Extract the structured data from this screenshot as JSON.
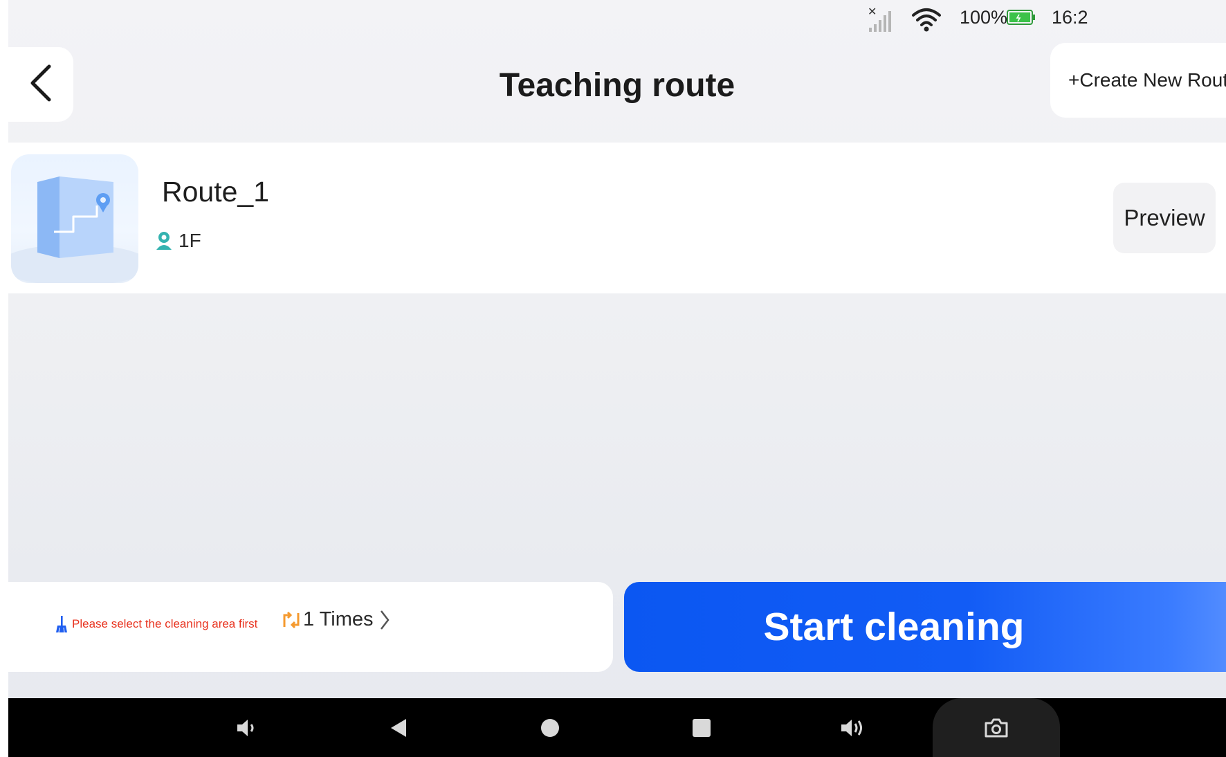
{
  "status_bar": {
    "battery_percent": "100%",
    "time": "16:2",
    "icons": [
      "no-signal-icon",
      "wifi-icon",
      "battery-icon"
    ]
  },
  "header": {
    "title": "Teaching route",
    "create_button": "+Create New Route",
    "back_icon": "back-arrow-icon"
  },
  "routes": [
    {
      "name": "Route_1",
      "floor": "1F",
      "preview_label": "Preview",
      "thumbnail_icon": "route-map-icon"
    }
  ],
  "bottom_panel": {
    "hint": "Please select the cleaning area first",
    "hint_icon": "broom-icon",
    "repeat_icon": "repeat-icon",
    "times": "1 Times",
    "start_button": "Start cleaning"
  },
  "nav_bar": {
    "buttons": [
      "volume-down-icon",
      "back-icon",
      "home-icon",
      "recents-icon",
      "volume-up-icon",
      "camera-icon"
    ]
  },
  "colors": {
    "accent": "#125cf5",
    "hint": "#e8331f",
    "repeat": "#f59a2f",
    "floor_icon": "#34b3b0"
  }
}
